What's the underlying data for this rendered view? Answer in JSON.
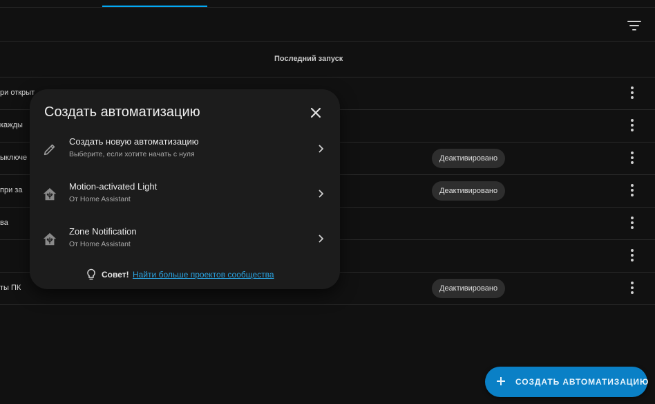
{
  "table": {
    "column_last_run": "Последний запуск",
    "rows": [
      {
        "name": "ри открыт",
        "last_run": "",
        "badge": ""
      },
      {
        "name": " кажды",
        "last_run": "",
        "badge": ""
      },
      {
        "name": "ыключе",
        "last_run": "",
        "badge": "Деактивировано"
      },
      {
        "name": " при за",
        "last_run": "",
        "badge": "Деактивировано"
      },
      {
        "name": "ва",
        "last_run": "",
        "badge": ""
      },
      {
        "name": "",
        "last_run": "",
        "badge": ""
      },
      {
        "name": "ты ПК",
        "last_run": "",
        "badge": "Деактивировано"
      }
    ]
  },
  "dialog": {
    "title": "Создать автоматизацию",
    "options": [
      {
        "title": "Создать новую автоматизацию",
        "subtitle": "Выберите, если хотите начать с нуля",
        "icon": "pencil-icon"
      },
      {
        "title": "Motion-activated Light",
        "subtitle": "От Home Assistant",
        "icon": "home-assistant-icon"
      },
      {
        "title": "Zone Notification",
        "subtitle": "От Home Assistant",
        "icon": "home-assistant-icon"
      }
    ],
    "tip_label": "Совет!",
    "tip_link": "Найти больше проектов сообщества"
  },
  "fab": {
    "label": "СОЗДАТЬ АВТОМАТИЗАЦИЮ"
  },
  "colors": {
    "accent": "#03a9f4",
    "fab": "#0a80c6",
    "link": "#2aa3e0",
    "dialog_bg": "#1c1c1c",
    "page_bg": "#111111"
  }
}
